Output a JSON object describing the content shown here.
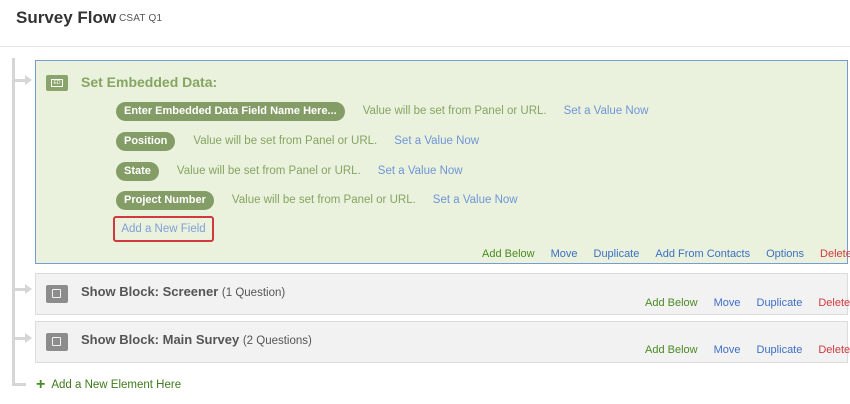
{
  "header": {
    "title": "Survey Flow",
    "subtitle": "CSAT Q1"
  },
  "embedded": {
    "icon": "embedded-data-icon",
    "icon_text": "ED",
    "title": "Set Embedded Data:",
    "fields": [
      {
        "name": "Enter Embedded Data Field Name Here...",
        "value": "Value will be set from Panel or URL.",
        "link": "Set a Value Now"
      },
      {
        "name": "Position",
        "value": "Value will be set from Panel or URL.",
        "link": "Set a Value Now"
      },
      {
        "name": "State",
        "value": "Value will be set from Panel or URL.",
        "link": "Set a Value Now"
      },
      {
        "name": "Project Number",
        "value": "Value will be set from Panel or URL.",
        "link": "Set a Value Now"
      }
    ],
    "add_field_label": "Add a New Field",
    "actions": {
      "add_below": "Add Below",
      "move": "Move",
      "duplicate": "Duplicate",
      "add_from_contacts": "Add From Contacts",
      "options": "Options",
      "delete": "Delete"
    }
  },
  "blocks": [
    {
      "title": "Show Block: Screener",
      "count": "(1 Question)",
      "actions": {
        "add_below": "Add Below",
        "move": "Move",
        "duplicate": "Duplicate",
        "delete": "Delete"
      }
    },
    {
      "title": "Show Block: Main Survey",
      "count": "(2 Questions)",
      "actions": {
        "add_below": "Add Below",
        "move": "Move",
        "duplicate": "Duplicate",
        "delete": "Delete"
      }
    }
  ],
  "add_element": {
    "icon": "plus-icon",
    "label": "Add a New Element Here"
  },
  "colors": {
    "embedded_bg": "#eaf2dd",
    "pill": "#849c66",
    "link_blue": "#6f95d8",
    "action_green": "#4a8a23",
    "delete_red": "#d0393e",
    "highlight_border": "#d0393e"
  }
}
